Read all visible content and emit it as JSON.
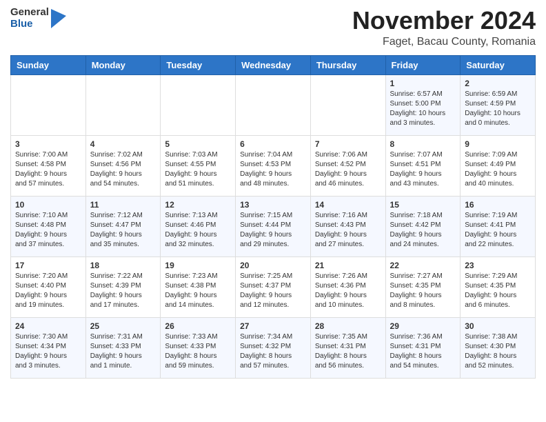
{
  "header": {
    "logo_general": "General",
    "logo_blue": "Blue",
    "month_title": "November 2024",
    "location": "Faget, Bacau County, Romania"
  },
  "weekdays": [
    "Sunday",
    "Monday",
    "Tuesday",
    "Wednesday",
    "Thursday",
    "Friday",
    "Saturday"
  ],
  "weeks": [
    [
      {
        "day": "",
        "info": ""
      },
      {
        "day": "",
        "info": ""
      },
      {
        "day": "",
        "info": ""
      },
      {
        "day": "",
        "info": ""
      },
      {
        "day": "",
        "info": ""
      },
      {
        "day": "1",
        "info": "Sunrise: 6:57 AM\nSunset: 5:00 PM\nDaylight: 10 hours\nand 3 minutes."
      },
      {
        "day": "2",
        "info": "Sunrise: 6:59 AM\nSunset: 4:59 PM\nDaylight: 10 hours\nand 0 minutes."
      }
    ],
    [
      {
        "day": "3",
        "info": "Sunrise: 7:00 AM\nSunset: 4:58 PM\nDaylight: 9 hours\nand 57 minutes."
      },
      {
        "day": "4",
        "info": "Sunrise: 7:02 AM\nSunset: 4:56 PM\nDaylight: 9 hours\nand 54 minutes."
      },
      {
        "day": "5",
        "info": "Sunrise: 7:03 AM\nSunset: 4:55 PM\nDaylight: 9 hours\nand 51 minutes."
      },
      {
        "day": "6",
        "info": "Sunrise: 7:04 AM\nSunset: 4:53 PM\nDaylight: 9 hours\nand 48 minutes."
      },
      {
        "day": "7",
        "info": "Sunrise: 7:06 AM\nSunset: 4:52 PM\nDaylight: 9 hours\nand 46 minutes."
      },
      {
        "day": "8",
        "info": "Sunrise: 7:07 AM\nSunset: 4:51 PM\nDaylight: 9 hours\nand 43 minutes."
      },
      {
        "day": "9",
        "info": "Sunrise: 7:09 AM\nSunset: 4:49 PM\nDaylight: 9 hours\nand 40 minutes."
      }
    ],
    [
      {
        "day": "10",
        "info": "Sunrise: 7:10 AM\nSunset: 4:48 PM\nDaylight: 9 hours\nand 37 minutes."
      },
      {
        "day": "11",
        "info": "Sunrise: 7:12 AM\nSunset: 4:47 PM\nDaylight: 9 hours\nand 35 minutes."
      },
      {
        "day": "12",
        "info": "Sunrise: 7:13 AM\nSunset: 4:46 PM\nDaylight: 9 hours\nand 32 minutes."
      },
      {
        "day": "13",
        "info": "Sunrise: 7:15 AM\nSunset: 4:44 PM\nDaylight: 9 hours\nand 29 minutes."
      },
      {
        "day": "14",
        "info": "Sunrise: 7:16 AM\nSunset: 4:43 PM\nDaylight: 9 hours\nand 27 minutes."
      },
      {
        "day": "15",
        "info": "Sunrise: 7:18 AM\nSunset: 4:42 PM\nDaylight: 9 hours\nand 24 minutes."
      },
      {
        "day": "16",
        "info": "Sunrise: 7:19 AM\nSunset: 4:41 PM\nDaylight: 9 hours\nand 22 minutes."
      }
    ],
    [
      {
        "day": "17",
        "info": "Sunrise: 7:20 AM\nSunset: 4:40 PM\nDaylight: 9 hours\nand 19 minutes."
      },
      {
        "day": "18",
        "info": "Sunrise: 7:22 AM\nSunset: 4:39 PM\nDaylight: 9 hours\nand 17 minutes."
      },
      {
        "day": "19",
        "info": "Sunrise: 7:23 AM\nSunset: 4:38 PM\nDaylight: 9 hours\nand 14 minutes."
      },
      {
        "day": "20",
        "info": "Sunrise: 7:25 AM\nSunset: 4:37 PM\nDaylight: 9 hours\nand 12 minutes."
      },
      {
        "day": "21",
        "info": "Sunrise: 7:26 AM\nSunset: 4:36 PM\nDaylight: 9 hours\nand 10 minutes."
      },
      {
        "day": "22",
        "info": "Sunrise: 7:27 AM\nSunset: 4:35 PM\nDaylight: 9 hours\nand 8 minutes."
      },
      {
        "day": "23",
        "info": "Sunrise: 7:29 AM\nSunset: 4:35 PM\nDaylight: 9 hours\nand 6 minutes."
      }
    ],
    [
      {
        "day": "24",
        "info": "Sunrise: 7:30 AM\nSunset: 4:34 PM\nDaylight: 9 hours\nand 3 minutes."
      },
      {
        "day": "25",
        "info": "Sunrise: 7:31 AM\nSunset: 4:33 PM\nDaylight: 9 hours\nand 1 minute."
      },
      {
        "day": "26",
        "info": "Sunrise: 7:33 AM\nSunset: 4:33 PM\nDaylight: 8 hours\nand 59 minutes."
      },
      {
        "day": "27",
        "info": "Sunrise: 7:34 AM\nSunset: 4:32 PM\nDaylight: 8 hours\nand 57 minutes."
      },
      {
        "day": "28",
        "info": "Sunrise: 7:35 AM\nSunset: 4:31 PM\nDaylight: 8 hours\nand 56 minutes."
      },
      {
        "day": "29",
        "info": "Sunrise: 7:36 AM\nSunset: 4:31 PM\nDaylight: 8 hours\nand 54 minutes."
      },
      {
        "day": "30",
        "info": "Sunrise: 7:38 AM\nSunset: 4:30 PM\nDaylight: 8 hours\nand 52 minutes."
      }
    ]
  ]
}
